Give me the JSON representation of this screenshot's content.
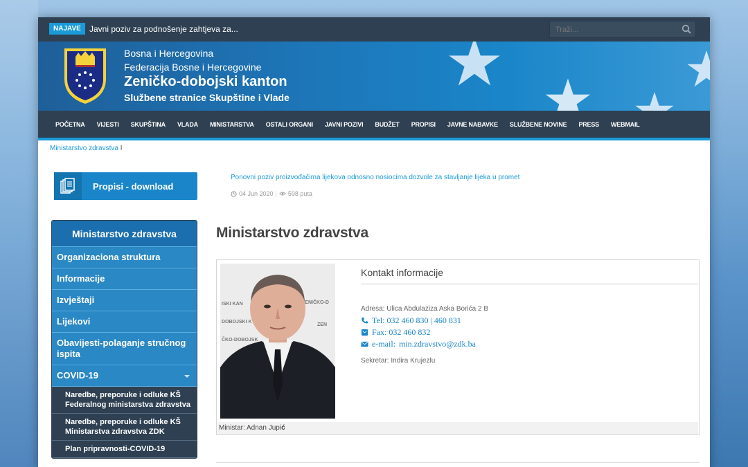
{
  "topbar": {
    "badge": "NAJAVE",
    "ticker": "Javni poziv za podnošenje zahtjeva za...",
    "search_placeholder": "Traži..."
  },
  "header": {
    "line1": "Bosna i Hercegovina",
    "line2": "Federacija Bosne i Hercegovine",
    "title": "Zeničko-dobojski kanton",
    "subtitle": "Službene stranice Skupštine i Vlade"
  },
  "nav": [
    "POČETNA",
    "VIJESTI",
    "SKUPŠTINA",
    "VLADA",
    "MINISTARSTVA",
    "OSTALI ORGANI",
    "JAVNI POZIVI",
    "BUDŽET",
    "PROPISI",
    "JAVNE NABAVKE",
    "SLUŽBENE NOVINE",
    "PRESS",
    "WEBMAIL"
  ],
  "breadcrumb": {
    "item": "Ministarstvo zdravstva",
    "sep": "I"
  },
  "propisi": {
    "label": "Propisi - download"
  },
  "sidebar": {
    "title": "Ministarstvo zdravstva",
    "items": [
      "Organizaciona struktura",
      "Informacije",
      "Izvještaji",
      "Lijekovi",
      "Obavijesti-polaganje stručnog ispita",
      "COVID-19"
    ],
    "subitems": [
      "Naredbe, preporuke i odluke KŠ Federalnog ministarstva zdravstva",
      "Naredbe, preporuke i odluke KŠ Ministarstva zdravstva ZDK",
      "Plan pripravnosti-COVID-19"
    ]
  },
  "news": {
    "link": "Ponovni poziv proizvođačima lijekova odnosno nosiocima dozvole za stavljanje lijeka u promet",
    "date": "04 Jun 2020",
    "views": "598 puta"
  },
  "main": {
    "title": "Ministarstvo zdravstva",
    "caption_prefix": "Ministar: Adnan Jupi",
    "caption_bold": "ć",
    "kontakt_title": "Kontakt informacije",
    "adresa": "Adresa: Ulica Abdulaziza Aska Borića 2 B",
    "tel": "Tel:  032 460 830 | 460 831",
    "fax": "Fax: 032 460 832",
    "email_label": "e-mail:",
    "email": "min.zdravstvo@zdk.ba",
    "sekretar": "Sekretar: Indira Krujezlu"
  },
  "colors": {
    "accent": "#1a9ad7",
    "dark": "#2e4052",
    "header_blue": "#1d76b8"
  }
}
